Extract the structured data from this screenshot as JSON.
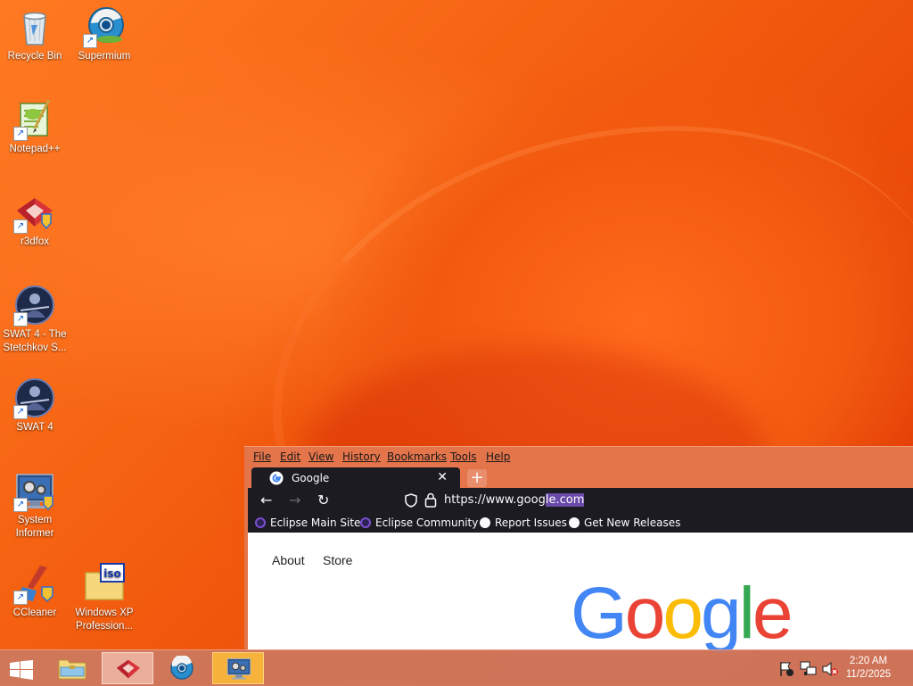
{
  "desktop": {
    "icons": [
      {
        "label": "Recycle Bin",
        "icon": "recycle-bin-icon"
      },
      {
        "label": "Supermium",
        "icon": "supermium-browser-icon"
      },
      {
        "label": "Notepad++",
        "icon": "notepad-plus-plus-icon"
      },
      {
        "label": "r3dfox",
        "icon": "r3dfox-icon"
      },
      {
        "label": "SWAT 4 - The Stetchkov S...",
        "icon": "swat4-expansion-icon"
      },
      {
        "label": "SWAT 4",
        "icon": "swat4-icon"
      },
      {
        "label": "System Informer",
        "icon": "system-informer-icon"
      },
      {
        "label": "CCleaner",
        "icon": "ccleaner-icon"
      },
      {
        "label": "Windows XP Profession...",
        "icon": "iso-file-icon"
      }
    ]
  },
  "browser": {
    "menu": [
      "File",
      "Edit",
      "View",
      "History",
      "Bookmarks",
      "Tools",
      "Help"
    ],
    "tab_title": "Google",
    "tab_close": "✕",
    "new_tab": "+",
    "url_prefix": "https://www.goog",
    "url_selected": "le.com",
    "bookmarks": [
      "Eclipse Main Site",
      "Eclipse Community",
      "Report Issues",
      "Get New Releases"
    ],
    "page_links": [
      "About",
      "Store"
    ],
    "logo_letters": [
      "G",
      "o",
      "o",
      "g",
      "l",
      "e"
    ],
    "colors": {
      "chrome_dark": "#1c1b22",
      "selection": "#6a4aa8"
    }
  },
  "taskbar": {
    "clock_time": "2:20 AM",
    "clock_date": "11/2/2025",
    "items": [
      "windows-start-icon",
      "file-explorer-icon",
      "r3dfox-icon",
      "supermium-browser-icon",
      "system-informer-icon"
    ],
    "tray_icons": [
      "action-center-flag-icon",
      "network-icon",
      "volume-muted-icon"
    ]
  }
}
